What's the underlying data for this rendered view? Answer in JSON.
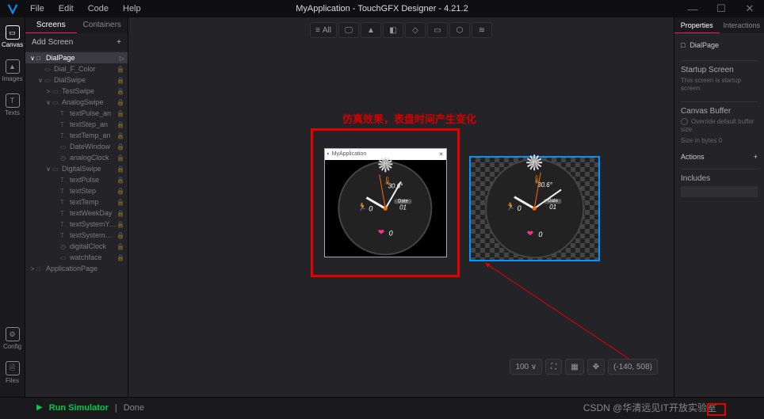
{
  "app": {
    "title": "MyApplication - TouchGFX Designer - 4.21.2",
    "menu": [
      "File",
      "Edit",
      "Code",
      "Help"
    ]
  },
  "rail": [
    {
      "label": "Canvas"
    },
    {
      "label": "Images"
    },
    {
      "label": "Texts"
    },
    {
      "label": "Config"
    },
    {
      "label": "Files"
    }
  ],
  "tree": {
    "tabs": [
      "Screens",
      "Containers"
    ],
    "add": "Add Screen",
    "items": [
      {
        "d": 0,
        "c": "∨",
        "t": "□",
        "label": "DialPage",
        "sel": true,
        "go": true
      },
      {
        "d": 1,
        "c": "",
        "t": "▭",
        "label": "Dial_F_Color",
        "lock": true
      },
      {
        "d": 1,
        "c": "∨",
        "t": "▭",
        "label": "DialSwipe",
        "lock": true
      },
      {
        "d": 2,
        "c": ">",
        "t": "▭",
        "label": "TestSwipe",
        "lock": true
      },
      {
        "d": 2,
        "c": "∨",
        "t": "▭",
        "label": "AnalogSwipe",
        "lock": true
      },
      {
        "d": 3,
        "c": "",
        "t": "T",
        "label": "textPulse_an",
        "lock": true
      },
      {
        "d": 3,
        "c": "",
        "t": "T",
        "label": "textStep_an",
        "lock": true
      },
      {
        "d": 3,
        "c": "",
        "t": "T",
        "label": "textTemp_an",
        "lock": true
      },
      {
        "d": 3,
        "c": "",
        "t": "▭",
        "label": "DateWindow",
        "lock": true
      },
      {
        "d": 3,
        "c": "",
        "t": "◷",
        "label": "analogClock",
        "lock": true
      },
      {
        "d": 2,
        "c": "∨",
        "t": "▭",
        "label": "DigitalSwipe",
        "lock": true
      },
      {
        "d": 3,
        "c": "",
        "t": "T",
        "label": "textPulse",
        "lock": true
      },
      {
        "d": 3,
        "c": "",
        "t": "T",
        "label": "textStep",
        "lock": true
      },
      {
        "d": 3,
        "c": "",
        "t": "T",
        "label": "textTemp",
        "lock": true
      },
      {
        "d": 3,
        "c": "",
        "t": "T",
        "label": "textWeekDay",
        "lock": true
      },
      {
        "d": 3,
        "c": "",
        "t": "T",
        "label": "textSystemYear",
        "lock": true
      },
      {
        "d": 3,
        "c": "",
        "t": "T",
        "label": "textSystemDate",
        "lock": true
      },
      {
        "d": 3,
        "c": "",
        "t": "◷",
        "label": "digitalClock",
        "lock": true
      },
      {
        "d": 3,
        "c": "",
        "t": "▭",
        "label": "watchface",
        "lock": true
      },
      {
        "d": 0,
        "c": ">",
        "t": "□",
        "label": "ApplicationPage"
      }
    ]
  },
  "toolbar": {
    "all": "All"
  },
  "annotation": "仿真效果，表盘时间产生变化",
  "sim": {
    "title": "MyApplication"
  },
  "watch": {
    "temp": "30.6°",
    "steps": "0",
    "pulse": "0",
    "date_label": "Date",
    "date_value": "01"
  },
  "bottom": {
    "zoom": "100",
    "dropdown": "∨",
    "coords": "(-140, 508)"
  },
  "props": {
    "tabs": [
      "Properties",
      "Interactions"
    ],
    "name": "DialPage",
    "startup_title": "Startup Screen",
    "startup_sub": "This screen is startup screen",
    "canvasbuf": "Canvas Buffer",
    "override": "Override default buffer size",
    "sizehint": "Size in bytes  0",
    "actions": "Actions",
    "includes": "Includes"
  },
  "status": {
    "run": "Run Simulator",
    "sep": "|",
    "done": "Done"
  },
  "watermark": "CSDN @华清远见IT开放实验室"
}
